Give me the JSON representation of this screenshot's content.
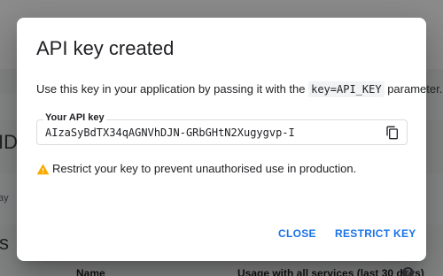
{
  "background": {
    "heading_fragment_1": "ID",
    "row_fragment": "ay",
    "heading_fragment_2": "s",
    "col_name": "Name",
    "col_usage": "Usage with all services (last 30 days)"
  },
  "dialog": {
    "title": "API key created",
    "description_before": "Use this key in your application by passing it with the ",
    "description_code": "key=API_KEY",
    "description_after": " parameter.",
    "field_label": "Your API key",
    "api_key": "AIzaSyBdTX34qAGNVhDJN-GRbGHtN2Xugygvp-I",
    "warning": "Restrict your key to prevent unauthorised use in production.",
    "close_label": "CLOSE",
    "restrict_label": "RESTRICT KEY"
  },
  "colors": {
    "accent": "#1a73e8",
    "warning": "#f9ab00",
    "text": "#202124",
    "border": "#dadce0"
  },
  "icons": {
    "copy": "copy-icon",
    "warning": "warning-icon",
    "help": "help-icon"
  }
}
